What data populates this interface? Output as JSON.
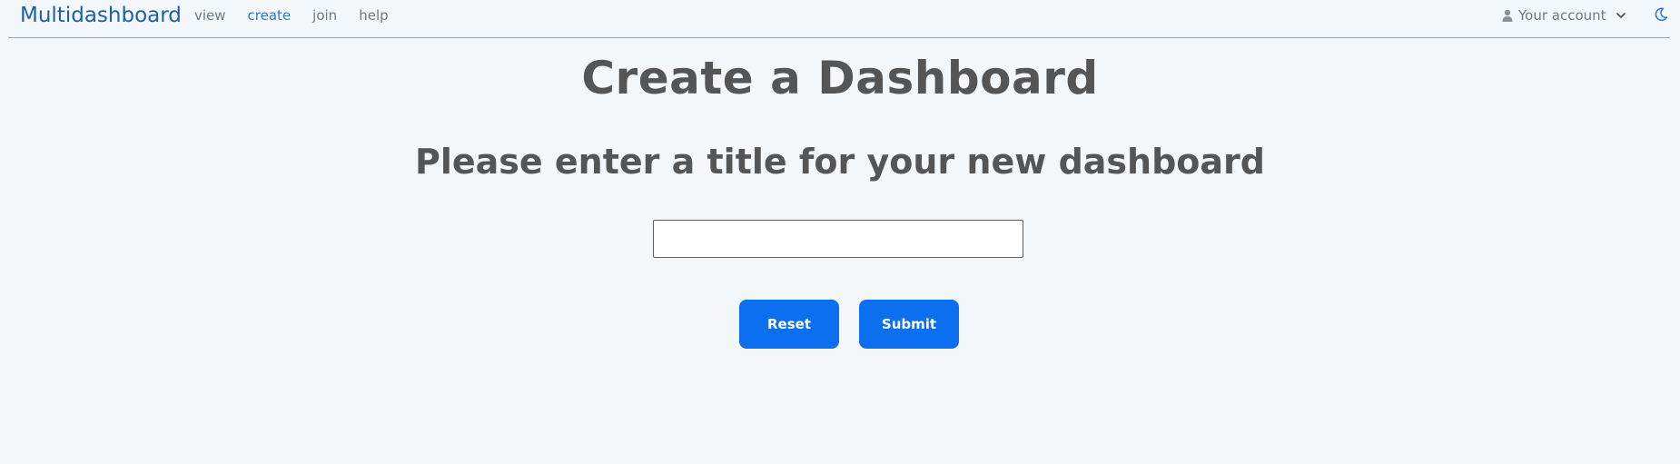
{
  "nav": {
    "brand": "Multidashboard",
    "links": [
      {
        "label": "view",
        "active": false
      },
      {
        "label": "create",
        "active": true
      },
      {
        "label": "join",
        "active": false
      },
      {
        "label": "help",
        "active": false
      }
    ],
    "account_label": "Your account",
    "account_icon": "user-icon",
    "theme_icon": "moon-icon"
  },
  "main": {
    "title": "Create a Dashboard",
    "prompt": "Please enter a title for your new dashboard",
    "title_input_value": "",
    "reset_label": "Reset",
    "submit_label": "Submit"
  },
  "colors": {
    "brand": "#1d5fa8",
    "active_link": "#2a7bd1",
    "button": "#0b6ff0",
    "background": "#f4f7fa"
  }
}
